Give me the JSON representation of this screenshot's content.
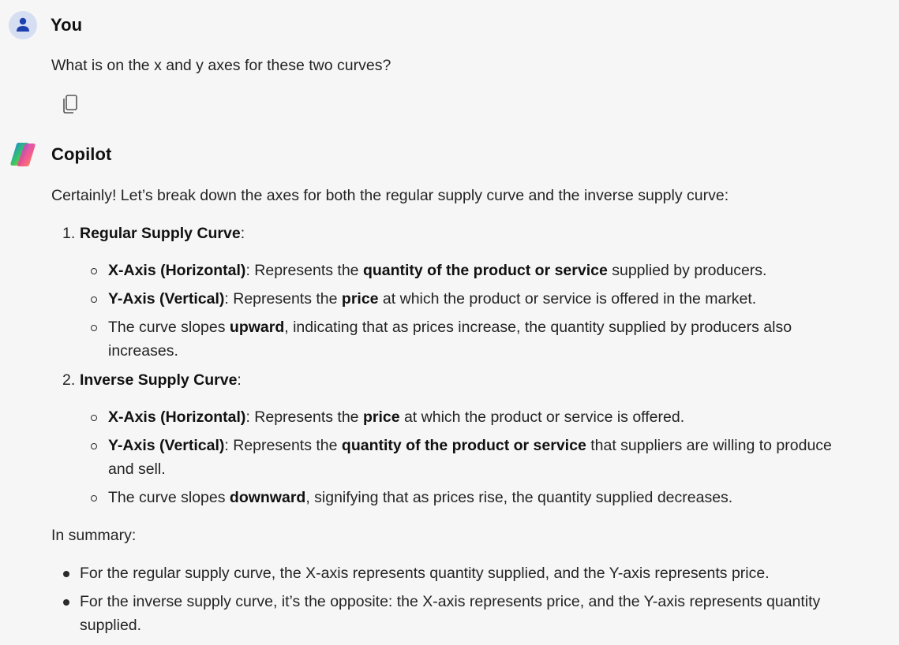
{
  "user_message": {
    "author": "You",
    "text": "What is on the x and y axes for these two curves?"
  },
  "copilot_message": {
    "author": "Copilot",
    "intro": "Certainly! Let’s break down the axes for both the regular supply curve and the inverse supply curve:",
    "item1": {
      "number": "1.",
      "title": "Regular Supply Curve",
      "colon": ":",
      "b1_label": "X-Axis (Horizontal)",
      "b1_mid": ": Represents the ",
      "b1_bold": "quantity of the product or service",
      "b1_end": " supplied by producers.",
      "b2_label": "Y-Axis (Vertical)",
      "b2_mid": ": Represents the ",
      "b2_bold": "price",
      "b2_end": " at which the product or service is offered in the market.",
      "b3_start": "The curve slopes ",
      "b3_bold": "upward",
      "b3_end": ", indicating that as prices increase, the quantity supplied by producers also",
      "b3_cont": "increases."
    },
    "item2": {
      "number": "2.",
      "title": "Inverse Supply Curve",
      "colon": ":",
      "b1_label": "X-Axis (Horizontal)",
      "b1_mid": ": Represents the ",
      "b1_bold": "price",
      "b1_end": " at which the product or service is offered.",
      "b2_label": "Y-Axis (Vertical)",
      "b2_mid": ": Represents the ",
      "b2_bold": "quantity of the product or service",
      "b2_end": " that suppliers are willing to produce",
      "b2_cont": "and sell.",
      "b3_start": "The curve slopes ",
      "b3_bold": "downward",
      "b3_end": ", signifying that as prices rise, the quantity supplied decreases."
    },
    "summary_label": "In summary:",
    "summary1": "For the regular supply curve, the X-axis represents quantity supplied, and the Y-axis represents price.",
    "summary2": "For the inverse supply curve, it’s the opposite: the X-axis represents price, and the Y-axis represents quantity",
    "summary2_cont": "supplied."
  },
  "icons": {
    "user_avatar": "person-icon",
    "copilot_logo": "copilot-logo-icon",
    "copy": "copy-icon"
  },
  "colors": {
    "background": "#f6f6f6",
    "avatar_bg": "#d6def2",
    "avatar_fg": "#1e3fae"
  }
}
